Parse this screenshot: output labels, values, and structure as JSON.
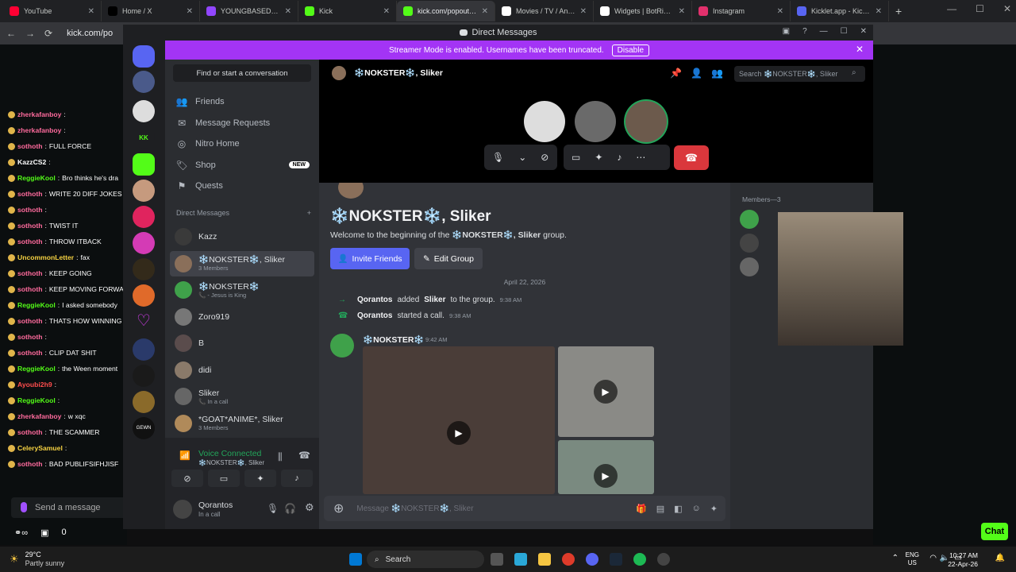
{
  "browser": {
    "tabs": [
      {
        "title": "YouTube",
        "color": "#ff0033"
      },
      {
        "title": "Home / X",
        "color": "#000000"
      },
      {
        "title": "YOUNGBASEDGO - Tw",
        "color": "#9146ff"
      },
      {
        "title": "Kick",
        "color": "#53fc18"
      },
      {
        "title": "kick.com/popout/qor",
        "color": "#53fc18"
      },
      {
        "title": "Movies / TV / Anime",
        "color": "#ffffff"
      },
      {
        "title": "Widgets | BotRix — Ch",
        "color": "#ffffff"
      },
      {
        "title": "Instagram",
        "color": "#e1306c"
      },
      {
        "title": "Kicklet.app - Kick Ch",
        "color": "#5865f2"
      }
    ],
    "url": "kick.com/po"
  },
  "kick_chat": {
    "lines": [
      {
        "user": "zherkafanboy",
        "color": "#ff6b9d",
        "msg": ""
      },
      {
        "user": "zherkafanboy",
        "color": "#ff6b9d",
        "msg": ""
      },
      {
        "user": "sothoth",
        "color": "#ff6b9d",
        "msg": "FULL FORCE"
      },
      {
        "user": "KazzCS2",
        "color": "#ffffff",
        "msg": ""
      },
      {
        "user": "ReggieKool",
        "color": "#53fc18",
        "msg": "Bro thinks he's dra"
      },
      {
        "user": "sothoth",
        "color": "#ff6b9d",
        "msg": "WRITE 20 DIFF JOKES"
      },
      {
        "user": "sothoth",
        "color": "#ff6b9d",
        "msg": ""
      },
      {
        "user": "sothoth",
        "color": "#ff6b9d",
        "msg": "TWIST IT"
      },
      {
        "user": "sothoth",
        "color": "#ff6b9d",
        "msg": "THROW ITBACK"
      },
      {
        "user": "UncommonLetter",
        "color": "#f5d142",
        "msg": "fax"
      },
      {
        "user": "sothoth",
        "color": "#ff6b9d",
        "msg": "KEEP GOING"
      },
      {
        "user": "sothoth",
        "color": "#ff6b9d",
        "msg": "KEEP MOVING FORWA"
      },
      {
        "user": "ReggieKool",
        "color": "#53fc18",
        "msg": "I asked somebody"
      },
      {
        "user": "sothoth",
        "color": "#ff6b9d",
        "msg": "THATS HOW WINNING"
      },
      {
        "user": "sothoth",
        "color": "#ff6b9d",
        "msg": ""
      },
      {
        "user": "sothoth",
        "color": "#ff6b9d",
        "msg": "CLIP DAT SHIT"
      },
      {
        "user": "ReggieKool",
        "color": "#53fc18",
        "msg": "the Ween moment"
      },
      {
        "user": "Ayoubi2h9",
        "color": "#ff4d4d",
        "msg": ""
      },
      {
        "user": "ReggieKool",
        "color": "#53fc18",
        "msg": ""
      },
      {
        "user": "zherkafanboy",
        "color": "#ff6b9d",
        "msg": "w xqc"
      },
      {
        "user": "sothoth",
        "color": "#ff6b9d",
        "msg": "THE SCAMMER"
      },
      {
        "user": "CelerySamuel",
        "color": "#f5d142",
        "msg": ""
      },
      {
        "user": "sothoth",
        "color": "#ff6b9d",
        "msg": "BAD PUBLIFSIFHJISF"
      }
    ],
    "send_placeholder": "Send a message",
    "bottom_count": "0",
    "chat_button": "Chat"
  },
  "discord": {
    "window_title": "Direct Messages",
    "banner": {
      "text": "Streamer Mode is enabled. Usernames have been truncated.",
      "button": "Disable"
    },
    "find_conversation": "Find or start a conversation",
    "nav": [
      {
        "label": "Friends",
        "icon": "friends-icon"
      },
      {
        "label": "Message Requests",
        "icon": "mail-icon"
      },
      {
        "label": "Nitro Home",
        "icon": "nitro-icon"
      },
      {
        "label": "Shop",
        "icon": "shop-icon",
        "badge": "NEW"
      },
      {
        "label": "Quests",
        "icon": "quests-icon"
      }
    ],
    "dm_header": "Direct Messages",
    "dms": [
      {
        "name": "Kazz",
        "sub": "",
        "color": "#3a3a3a"
      },
      {
        "name": "❄️NOKSTER❄️, Sliker",
        "sub": "3 Members",
        "color": "#8a6f5a"
      },
      {
        "name": "❄️NOKSTER❄️",
        "sub": "📞 - Jesus is King",
        "color": "#3fa14a"
      },
      {
        "name": "Zoro919",
        "sub": "",
        "color": "#777777"
      },
      {
        "name": "B",
        "sub": "",
        "color": "#5a4c4c"
      },
      {
        "name": "didi",
        "sub": "",
        "color": "#8a7a6a"
      },
      {
        "name": "Sliker",
        "sub": "📞 In a call",
        "color": "#666666"
      },
      {
        "name": "*GOAT*ANIME*, Sliker",
        "sub": "3 Members",
        "color": "#b08a5a"
      }
    ],
    "voice": {
      "status": "Voice Connected",
      "channel": "❄️NOKSTER❄️, Sliker"
    },
    "user": {
      "name": "Qorantos",
      "status": "In a call"
    },
    "call": {
      "name": "❄️NOKSTER❄️, Sliker",
      "search_placeholder": "Search ❄️NOKSTER❄️, Sliker"
    },
    "chat": {
      "title": "❄️NOKSTER❄️, Sliker",
      "welcome_prefix": "Welcome to the beginning of the ",
      "welcome_group": "❄️NOKSTER❄️, Sliker",
      "welcome_suffix": " group.",
      "invite_button": "Invite Friends",
      "edit_button": "Edit Group",
      "date": "April 22, 2026",
      "system": [
        {
          "actor": "Qorantos",
          "text1": " added ",
          "target": "Sliker",
          "text2": " to the group.",
          "time": "9:38 AM"
        },
        {
          "actor": "Qorantos",
          "text1": " started a call.",
          "target": "",
          "text2": "",
          "time": "9:38 AM"
        }
      ],
      "message_author": "❄️NOKSTER❄️",
      "message_time": "9:42 AM",
      "composer_placeholder": "Message ❄️NOKSTER❄️, Sliker"
    },
    "members_header": "Members—3"
  },
  "taskbar": {
    "temp": "29°C",
    "weather": "Partly sunny",
    "search": "Search",
    "lang1": "ENG",
    "lang2": "US",
    "time": "10:27 AM",
    "date": "22-Apr-26"
  }
}
